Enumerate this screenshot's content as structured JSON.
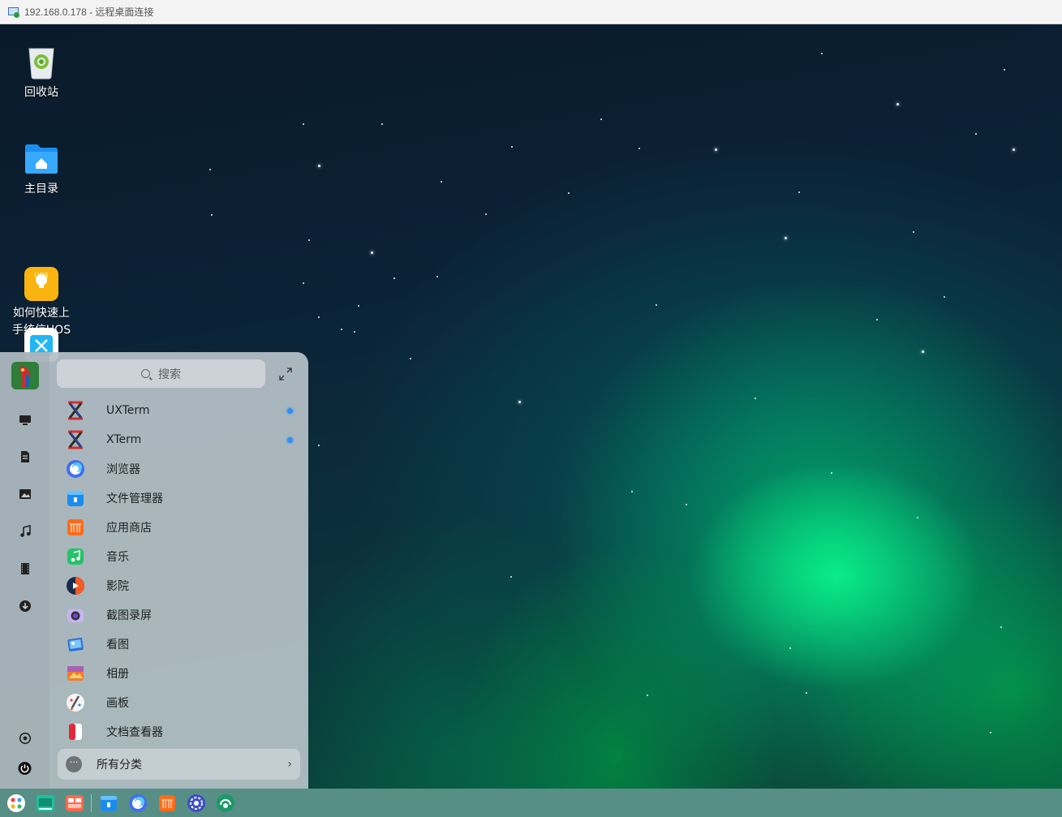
{
  "window": {
    "title": "192.168.0.178 - 远程桌面连接"
  },
  "desktop": {
    "icons": [
      {
        "label": "回收站",
        "icon": "trash-icon"
      },
      {
        "label": "主目录",
        "icon": "home-folder-icon"
      },
      {
        "label": "如何快速上\n手统信UOS",
        "icon": "uos-guide-icon",
        "badge": "UOS"
      },
      {
        "label": "",
        "icon": "app-store-shortcut-icon"
      }
    ]
  },
  "launcher": {
    "search": {
      "placeholder": "搜索"
    },
    "sidebar": [
      {
        "name": "computer-icon"
      },
      {
        "name": "documents-icon"
      },
      {
        "name": "pictures-icon"
      },
      {
        "name": "music-icon"
      },
      {
        "name": "videos-icon"
      },
      {
        "name": "downloads-icon"
      },
      {
        "name": "settings-icon"
      },
      {
        "name": "power-icon"
      }
    ],
    "apps": [
      {
        "label": "UXTerm",
        "icon": "uxterm-icon",
        "new": true
      },
      {
        "label": "XTerm",
        "icon": "xterm-icon",
        "new": true
      },
      {
        "label": "浏览器",
        "icon": "browser-icon",
        "new": false
      },
      {
        "label": "文件管理器",
        "icon": "file-manager-icon",
        "new": false
      },
      {
        "label": "应用商店",
        "icon": "app-store-icon",
        "new": false
      },
      {
        "label": "音乐",
        "icon": "music-app-icon",
        "new": false
      },
      {
        "label": "影院",
        "icon": "movie-icon",
        "new": false
      },
      {
        "label": "截图录屏",
        "icon": "screenshot-icon",
        "new": false
      },
      {
        "label": "看图",
        "icon": "image-viewer-icon",
        "new": false
      },
      {
        "label": "相册",
        "icon": "album-icon",
        "new": false
      },
      {
        "label": "画板",
        "icon": "draw-icon",
        "new": false
      },
      {
        "label": "文档查看器",
        "icon": "document-viewer-icon",
        "new": false
      }
    ],
    "all_categories": {
      "label": "所有分类",
      "more": "···",
      "chevron": "›"
    }
  },
  "taskbar": {
    "items": [
      {
        "name": "launcher-icon"
      },
      {
        "name": "multitask-view-icon"
      },
      {
        "name": "workspace-icon"
      },
      {
        "name": "file-manager-icon"
      },
      {
        "name": "browser-icon"
      },
      {
        "name": "app-store-icon"
      },
      {
        "name": "control-center-icon"
      },
      {
        "name": "remote-assist-icon"
      }
    ]
  }
}
